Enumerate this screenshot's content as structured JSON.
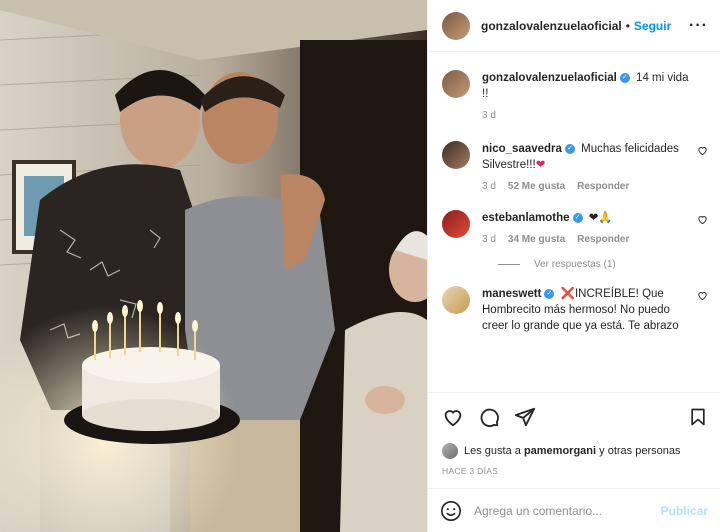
{
  "post": {
    "image_alt": "Birthday photo"
  },
  "header": {
    "username": "gonzalovalenzuelaoficial",
    "separator": "•",
    "follow_label": "Seguir",
    "more_label": "···"
  },
  "caption": {
    "username": "gonzalovalenzuelaoficial",
    "text": "14 mi vida !!",
    "time": "3 d"
  },
  "comments": [
    {
      "username": "nico_saavedra",
      "text": "Muchas felicidades Silvestre!!!",
      "emoji": "❤",
      "time": "3 d",
      "likes": "52 Me gusta",
      "reply_label": "Responder"
    },
    {
      "username": "estebanlamothe",
      "text": "",
      "emoji": "❤🙏",
      "time": "3 d",
      "likes": "34 Me gusta",
      "reply_label": "Responder",
      "view_replies": "Ver respuestas (1)"
    },
    {
      "username": "maneswett",
      "emoji_prefix": "❌",
      "text": "INCREÍBLE! Que Hombrecito más hermoso! No puedo creer lo grande que ya está. Te abrazo"
    }
  ],
  "likes_line": {
    "prefix": "Les gusta a",
    "user": "pamemorgani",
    "suffix": "y otras personas"
  },
  "date_label": "HACE 3 DÍAS",
  "add_comment": {
    "placeholder": "Agrega un comentario...",
    "publish_label": "Publicar"
  },
  "colors": {
    "accent": "#0095f6",
    "verified": "#3897f0",
    "muted": "#8e8e8e"
  }
}
